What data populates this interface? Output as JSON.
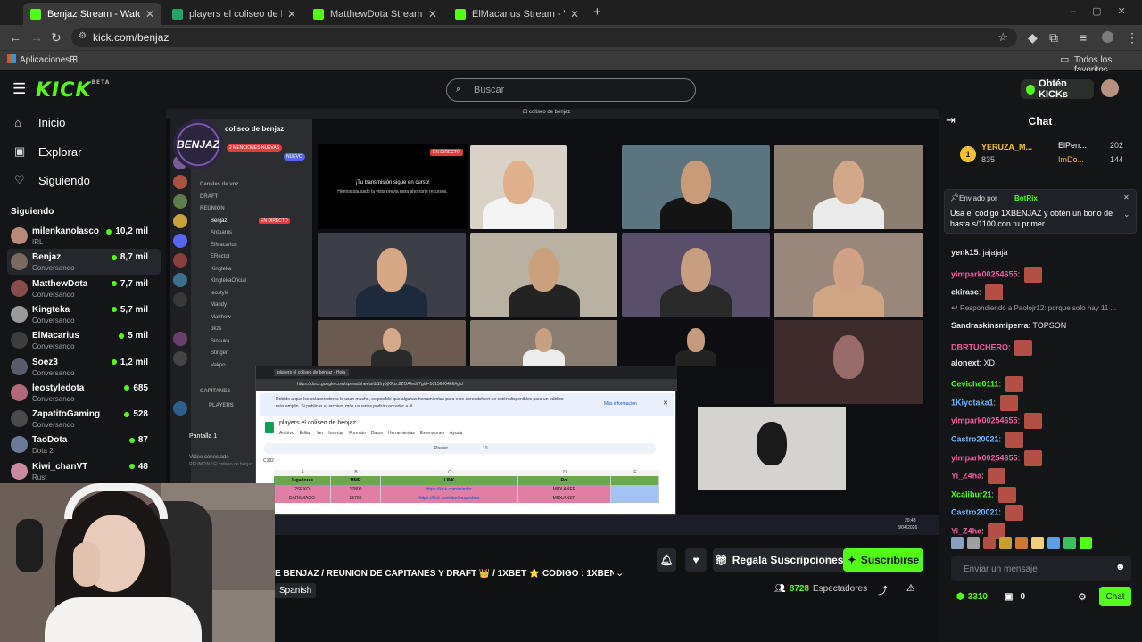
{
  "browser": {
    "tabs": [
      {
        "title": "Benjaz Stream - Watch Live",
        "active": true,
        "favicon_color": "#53fc18"
      },
      {
        "title": "players el coliseo de benjaz - H",
        "active": false,
        "favicon_color": "#22a565"
      },
      {
        "title": "MatthewDota Stream - Watch L",
        "active": false,
        "favicon_color": "#53fc18"
      },
      {
        "title": "ElMacarius Stream - Watch Live",
        "active": false,
        "favicon_color": "#53fc18"
      }
    ],
    "url": "kick.com/benjaz",
    "bookmarks": {
      "apps": "Aplicaciones",
      "all": "Todos los favoritos"
    }
  },
  "header": {
    "logo": "KICK",
    "logo_badge": "BETA",
    "search_placeholder": "Buscar",
    "get_kicks": "Obtén KICKs"
  },
  "sidebar": {
    "nav": [
      {
        "label": "Inicio",
        "icon": "home-icon"
      },
      {
        "label": "Explorar",
        "icon": "compass-icon"
      },
      {
        "label": "Siguiendo",
        "icon": "heart-icon"
      }
    ],
    "following_title": "Siguiendo",
    "channels": [
      {
        "name": "milenkanolasco",
        "category": "IRL",
        "viewers": "10,2 mil",
        "avatar_color": "#b98a7a",
        "selected": false
      },
      {
        "name": "Benjaz",
        "category": "Conversando",
        "viewers": "8,7 mil",
        "avatar_color": "#7a6a60",
        "selected": true
      },
      {
        "name": "MatthewDota",
        "category": "Conversando",
        "viewers": "7,7 mil",
        "avatar_color": "#8a4b4b",
        "selected": false
      },
      {
        "name": "Kingteka",
        "category": "Conversando",
        "viewers": "5,7 mil",
        "avatar_color": "#9a9a9a",
        "selected": false
      },
      {
        "name": "ElMacarius",
        "category": "Conversando",
        "viewers": "5 mil",
        "avatar_color": "#3d3d3d",
        "selected": false
      },
      {
        "name": "Soez3",
        "category": "Conversando",
        "viewers": "1,2 mil",
        "avatar_color": "#5a5a6a",
        "selected": false
      },
      {
        "name": "leostyledota",
        "category": "Conversando",
        "viewers": "685",
        "avatar_color": "#b0687a",
        "selected": false
      },
      {
        "name": "ZapatitoGaming",
        "category": "Conversando",
        "viewers": "528",
        "avatar_color": "#4a4a4a",
        "selected": false
      },
      {
        "name": "TaoDota",
        "category": "Dota 2",
        "viewers": "87",
        "avatar_color": "#6c7a9a",
        "selected": false
      },
      {
        "name": "Kiwi_chanVT",
        "category": "Rust",
        "viewers": "48",
        "avatar_color": "#c98aa0",
        "selected": false
      }
    ]
  },
  "video": {
    "window_title": "El coliseo de benjaz",
    "server_name": "coliseo de benjaz",
    "logo_text": "BENJAZ",
    "mentions_badge": "2 MENCIONES NUEVAS",
    "live_badge": "EN DIRECTO",
    "new_badge": "NUEVO",
    "stream_notice_title": "¡Tu transmisión sigue en curso!",
    "stream_notice_body": "Hemos pausado la vista previa para ahorrarte recursos.",
    "voice_channels": [
      "Canales de voz",
      "DRAFT",
      "REUNION",
      "Benjaz",
      "Antuarus",
      "ElMacarius",
      "ERector",
      "Kingteka",
      "KingtekaOficial",
      "leostyle",
      "Mandy",
      "Matthew",
      "pkzs",
      "Sinsuka",
      "Stinger",
      "Vakpo"
    ],
    "voice_live": "EN DIRECTO",
    "captains": "CAPITANES",
    "players": "PLAYERS",
    "screen": "Pantalla 1",
    "video_connected": "Video conectado",
    "video_sub": "REUNION / El coliseo de benjaz",
    "clock": "20:48",
    "date": "8/04/2026",
    "sheet": {
      "tab_title": "players el coliseo de benjaz - Hoja",
      "url": "https://docs.google.com/spreadsheets/d/1hy5jXRzc8ZOA/edit?gid=1615600466#gid",
      "banner": "Debido a que los colaboradores lo usan mucho, es posible que algunas herramientas para este spreadsheet no estén disponibles para un público más amplio. Si publicas el archivo, más usuarios podrán acceder a él.",
      "more_info": "Más información",
      "title": "players el coliseo de benjaz",
      "menus": [
        "Archivo",
        "Editar",
        "Ver",
        "Insertar",
        "Formato",
        "Datos",
        "Herramientas",
        "Extensiones",
        "Ayuda"
      ],
      "cell_ref": "C182",
      "font_name": "Predet...",
      "font_size": "10",
      "col_letters": [
        "A",
        "B",
        "C",
        "D",
        "E"
      ],
      "headers": [
        "Jugadores",
        "MMR",
        "LINK",
        "Rol"
      ],
      "rows": [
        [
          "2SEXO",
          "17800",
          "https://kick.com/mindoc",
          "MIDLANER"
        ],
        [
          "DARKMAGO",
          "15700",
          "https://kick.com/darkmagodota",
          "MIDLANER"
        ]
      ]
    }
  },
  "stream_info": {
    "title": "E BENJAZ / REUNION DE CAPITANES Y DRAFT 👑 / 1XBET ⭐ CÓDIGO : 1XBENJA...",
    "language": "Spanish",
    "viewers": "8728",
    "viewers_label": "Espectadores",
    "gift_label": "Regala Suscripciones",
    "subscribe_label": "Suscribirse"
  },
  "chat": {
    "title": "Chat",
    "leaders": [
      {
        "rank": "1",
        "name": "YERUZA_M...",
        "value": "835"
      },
      {
        "name": "ElPerr...",
        "value": "202"
      },
      {
        "name": "ImDo...",
        "value": "144"
      }
    ],
    "pinned_by_label": "Enviado por",
    "pinned_by": "BotRix",
    "pinned_text": "Usa el código 1XBENJAZ y obtén un bono de hasta s/1100 con tu primer...",
    "messages": [
      {
        "user": "yenk15",
        "color": "#e6e6e6",
        "text": "jajajaja",
        "emote": false
      },
      {
        "user": "yimpark00254655",
        "color": "#f05aa0",
        "text": "",
        "emote": true
      },
      {
        "user": "ekirase",
        "color": "#e6e6e6",
        "text": "",
        "emote": true
      },
      {
        "user": "",
        "color": "#9aa0a6",
        "text": "Respondiendo a Paolojr12: porque solo hay 11 ...",
        "emote": false,
        "reply": true
      },
      {
        "user": "Sandraskinsmiperra",
        "color": "#e6e6e6",
        "text": "TOPSON",
        "emote": false
      },
      {
        "user": "DBRTUCHERO",
        "color": "#f05aa0",
        "text": "",
        "emote": true
      },
      {
        "user": "alonext",
        "color": "#e6e6e6",
        "text": "XD",
        "emote": false
      },
      {
        "user": "Ceviche0111",
        "color": "#53fc18",
        "text": "",
        "emote": true
      },
      {
        "user": "1Kiyotaka1",
        "color": "#6cb6ff",
        "text": "",
        "emote": true
      },
      {
        "user": "yimpark00254655",
        "color": "#f05aa0",
        "text": "",
        "emote": true
      },
      {
        "user": "Castro20021",
        "color": "#6cb6ff",
        "text": "",
        "emote": true
      },
      {
        "user": "yimpark00254655",
        "color": "#f05aa0",
        "text": "",
        "emote": true
      },
      {
        "user": "Yi_Z4ha",
        "color": "#f05aa0",
        "text": "",
        "emote": true
      },
      {
        "user": "Xcalibur21",
        "color": "#53fc18",
        "text": "",
        "emote": true
      },
      {
        "user": "Castro20021",
        "color": "#6cb6ff",
        "text": "",
        "emote": true
      },
      {
        "user": "Yi_Z4ha",
        "color": "#f05aa0",
        "text": "",
        "emote": true
      }
    ],
    "input_placeholder": "Enviar un mensaje",
    "points": "3310",
    "count": "0",
    "send_label": "Chat"
  }
}
